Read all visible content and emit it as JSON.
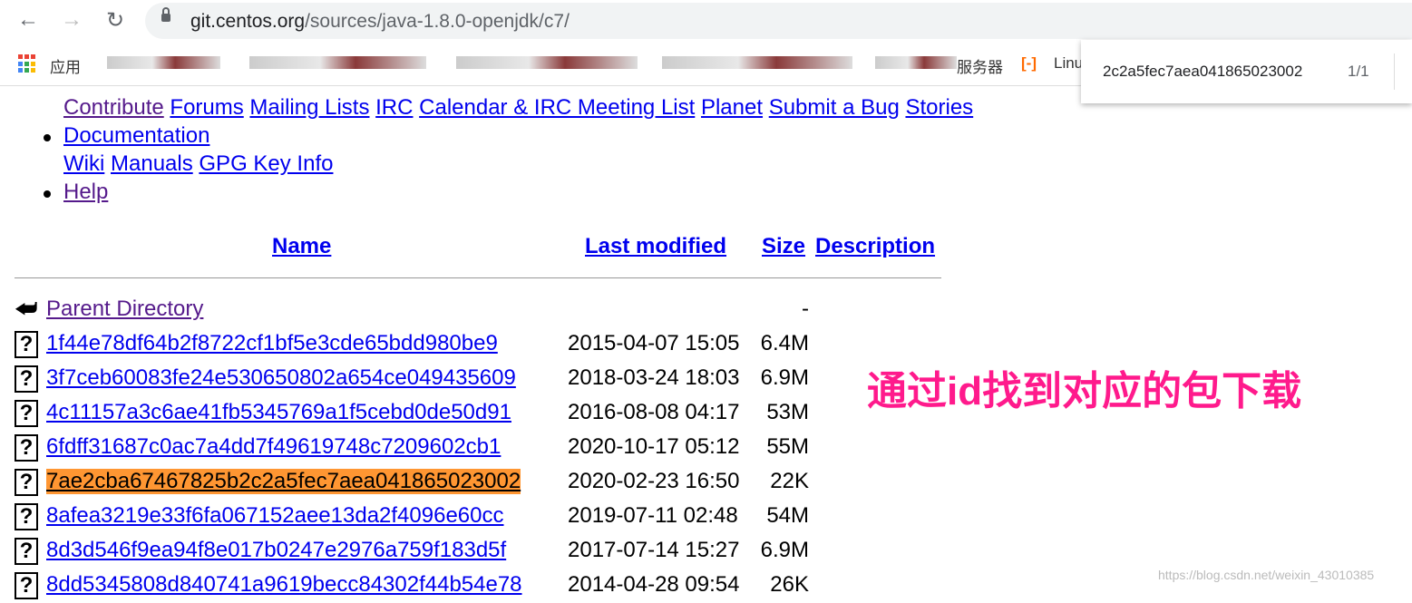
{
  "browser": {
    "url_host": "git.centos.org",
    "url_path": "/sources/java-1.8.0-openjdk/c7/"
  },
  "bookmarks": {
    "apps_label": "应用",
    "item_server": "服务器",
    "item_linux": "Linu"
  },
  "nav_links": {
    "row1": [
      "Contribute",
      "Forums",
      "Mailing Lists",
      "IRC",
      "Calendar & IRC Meeting List",
      "Planet",
      "Submit a Bug",
      "Stories"
    ],
    "documentation": "Documentation",
    "doc_links": [
      "Wiki",
      "Manuals",
      "GPG Key Info"
    ],
    "help": "Help"
  },
  "table": {
    "headers": {
      "name": "Name",
      "modified": "Last modified",
      "size": "Size",
      "description": "Description"
    },
    "parent": {
      "name": "Parent Directory",
      "size": "-"
    },
    "rows": [
      {
        "name": "1f44e78df64b2f8722cf1bf5e3cde65bdd980be9",
        "date": "2015-04-07 15:05",
        "size": "6.4M"
      },
      {
        "name": "3f7ceb60083fe24e530650802a654ce049435609",
        "date": "2018-03-24 18:03",
        "size": "6.9M"
      },
      {
        "name": "4c11157a3c6ae41fb5345769a1f5cebd0de50d91",
        "date": "2016-08-08 04:17",
        "size": "53M"
      },
      {
        "name": "6fdff31687c0ac7a4dd7f49619748c7209602cb1",
        "date": "2020-10-17 05:12",
        "size": "55M"
      },
      {
        "name": "7ae2cba67467825b2c2a5fec7aea041865023002",
        "date": "2020-02-23 16:50",
        "size": "22K",
        "highlighted": true
      },
      {
        "name": "8afea3219e33f6fa067152aee13da2f4096e60cc",
        "date": "2019-07-11 02:48",
        "size": "54M"
      },
      {
        "name": "8d3d546f9ea94f8e017b0247e2976a759f183d5f",
        "date": "2017-07-14 15:27",
        "size": "6.9M"
      },
      {
        "name": "8dd5345808d840741a9619becc84302f44b54e78",
        "date": "2014-04-28 09:54",
        "size": "26K"
      }
    ]
  },
  "find_bar": {
    "query": "2c2a5fec7aea041865023002",
    "count": "1/1"
  },
  "annotation": "通过id找到对应的包下载",
  "watermark": "https://blog.csdn.net/weixin_43010385",
  "colors": {
    "link": "#0000ee",
    "visited": "#551a8b",
    "highlight": "#ff9632",
    "annotation": "#ff1a8c"
  }
}
